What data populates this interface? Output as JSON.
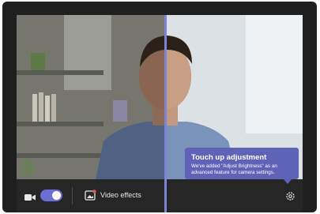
{
  "toolbar": {
    "camera_icon": "video-camera-icon",
    "camera_toggle_on": true,
    "effects_icon": "video-effects-icon",
    "effects_label": "Video effects",
    "settings_icon": "gear-icon"
  },
  "tooltip": {
    "title": "Touch up adjustment",
    "body": "We've added \"Adjust Brightness\" as an advanced feature for camera settings."
  },
  "colors": {
    "accent": "#6b6fd4",
    "tooltip_bg": "#5f63b8",
    "frame_bg": "#1f1f1f"
  }
}
